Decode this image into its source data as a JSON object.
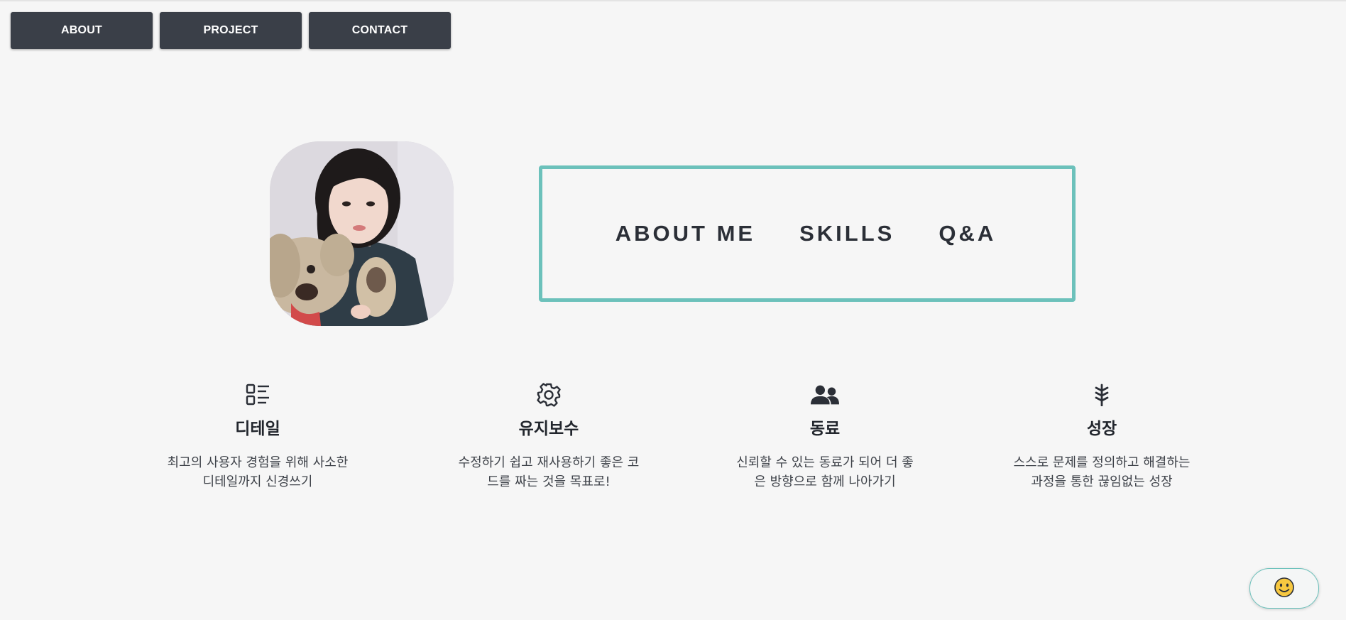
{
  "nav": {
    "items": [
      {
        "label": "ABOUT"
      },
      {
        "label": "PROJECT"
      },
      {
        "label": "CONTACT"
      }
    ]
  },
  "profile": {
    "image": "profile-photo-icon"
  },
  "intro": {
    "links": [
      {
        "label": "ABOUT ME"
      },
      {
        "label": "SKILLS"
      },
      {
        "label": "Q&A"
      }
    ],
    "border_color": "#6cc1bb"
  },
  "features": [
    {
      "icon": "list-detail-icon",
      "title": "디테일",
      "desc": "최고의 사용자 경험을 위해 사소한\n디테일까지 신경쓰기"
    },
    {
      "icon": "gear-icon",
      "title": "유지보수",
      "desc": "수정하기 쉽고 재사용하기 좋은 코\n드를 짜는 것을 목표로!"
    },
    {
      "icon": "users-icon",
      "title": "동료",
      "desc": "신뢰할 수 있는 동료가 되어 더 좋\n은 방향으로 함께 나아가기"
    },
    {
      "icon": "seedling-icon",
      "title": "성장",
      "desc": "스스로 문제를 정의하고 해결하는\n과정을 통한 끊임없는 성장"
    }
  ],
  "floating_button": {
    "icon": "smiley-icon"
  },
  "colors": {
    "nav_bg": "#3a3f48",
    "accent": "#6cc1bb",
    "page_bg": "#f6f6f6"
  }
}
